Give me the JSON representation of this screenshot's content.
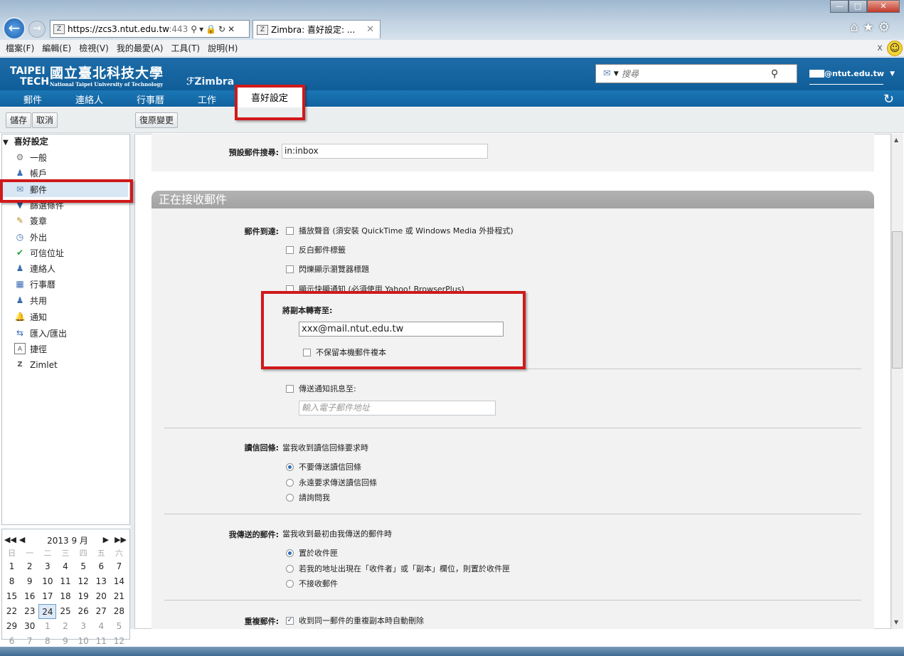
{
  "browser": {
    "url": "https://zcs3.ntut.edu.tw:443",
    "url_host": "https://zcs3.ntut.edu.tw",
    "url_port": ":443",
    "tab_title": "Zimbra: 喜好設定: ...",
    "menu": [
      "檔案(F)",
      "編輯(E)",
      "檢視(V)",
      "我的最愛(A)",
      "工具(T)",
      "說明(H)"
    ],
    "window_buttons": [
      "minimize",
      "maximize",
      "close"
    ]
  },
  "header": {
    "logo_taipei": "TAIPEI",
    "logo_tech": "TECH",
    "logo_chinese": "國立臺北科技大學",
    "logo_english": "National Taipei University of Technology",
    "zimbra": "Zimbra",
    "search_placeholder": "搜尋",
    "user_email_suffix": "@ntut.edu.tw"
  },
  "nav": {
    "tabs": [
      "郵件",
      "連絡人",
      "行事曆",
      "工作",
      "喜好設定"
    ],
    "active": "喜好設定"
  },
  "toolbar": {
    "save": "儲存",
    "cancel": "取消",
    "revert": "復原變更"
  },
  "sidebar": {
    "title": "喜好設定",
    "items": [
      {
        "label": "一般",
        "icon": "gear-icon"
      },
      {
        "label": "帳戶",
        "icon": "account-icon"
      },
      {
        "label": "郵件",
        "icon": "mail-icon"
      },
      {
        "label": "篩選條件",
        "icon": "filter-icon"
      },
      {
        "label": "簽章",
        "icon": "signature-icon"
      },
      {
        "label": "外出",
        "icon": "out-of-office-icon"
      },
      {
        "label": "可信位址",
        "icon": "trusted-shield-icon"
      },
      {
        "label": "連絡人",
        "icon": "contact-icon"
      },
      {
        "label": "行事曆",
        "icon": "calendar-icon"
      },
      {
        "label": "共用",
        "icon": "sharing-icon"
      },
      {
        "label": "通知",
        "icon": "bell-icon"
      },
      {
        "label": "匯入/匯出",
        "icon": "import-export-icon"
      },
      {
        "label": "捷徑",
        "icon": "shortcut-icon"
      },
      {
        "label": "Zimlet",
        "icon": "zimlet-icon"
      }
    ]
  },
  "calendar": {
    "month": "2013 9 月",
    "weekdays": [
      "日",
      "一",
      "二",
      "三",
      "四",
      "五",
      "六"
    ],
    "today": "24",
    "weeks": [
      [
        "1",
        "2",
        "3",
        "4",
        "5",
        "6",
        "7"
      ],
      [
        "8",
        "9",
        "10",
        "11",
        "12",
        "13",
        "14"
      ],
      [
        "15",
        "16",
        "17",
        "18",
        "19",
        "20",
        "21"
      ],
      [
        "22",
        "23",
        "24",
        "25",
        "26",
        "27",
        "28"
      ],
      [
        "29",
        "30",
        "1",
        "2",
        "3",
        "4",
        "5"
      ],
      [
        "6",
        "7",
        "8",
        "9",
        "10",
        "11",
        "12"
      ]
    ]
  },
  "content": {
    "default_search_label": "預設郵件搜尋:",
    "default_search_value": "in:inbox",
    "section_title": "正在接收郵件",
    "arrival_label": "郵件到達:",
    "arrival_options": [
      {
        "label": "播放聲音 (須安裝 QuickTime 或 Windows Media 外掛程式)",
        "checked": false
      },
      {
        "label": "反白郵件標籤",
        "checked": false
      },
      {
        "label": "閃爍顯示瀏覽器標題",
        "checked": false
      },
      {
        "label": "顯示快顯通知 (必須使用 Yahoo! BrowserPlus)",
        "checked": false
      }
    ],
    "forward_label": "將副本轉寄至:",
    "forward_value": "xxx@mail.ntut.edu.tw",
    "no_local_copy": "不保留本機郵件複本",
    "notify_label": "傳送通知訊息至:",
    "notify_placeholder": "輸入電子郵件地址",
    "read_receipt_label": "讀信回條:",
    "read_receipt_desc": "當我收到讀信回條要求時",
    "read_receipt_options": [
      {
        "label": "不要傳送讀信回條",
        "checked": true
      },
      {
        "label": "永遠要求傳送讀信回條",
        "checked": false
      },
      {
        "label": "請詢問我",
        "checked": false
      }
    ],
    "sent_label": "我傳送的郵件:",
    "sent_desc": "當我收到最初由我傳送的郵件時",
    "sent_options": [
      {
        "label": "置於收件匣",
        "checked": true
      },
      {
        "label": "若我的地址出現在「收件者」或「副本」欄位，則置於收件匣",
        "checked": false
      },
      {
        "label": "不接收郵件",
        "checked": false
      }
    ],
    "dup_label": "重複郵件:",
    "dup_option": {
      "label": "收到同一郵件的重複副本時自動刪除",
      "checked": true
    }
  },
  "colors": {
    "accent": "#1669a8",
    "highlight": "#d0191b"
  }
}
